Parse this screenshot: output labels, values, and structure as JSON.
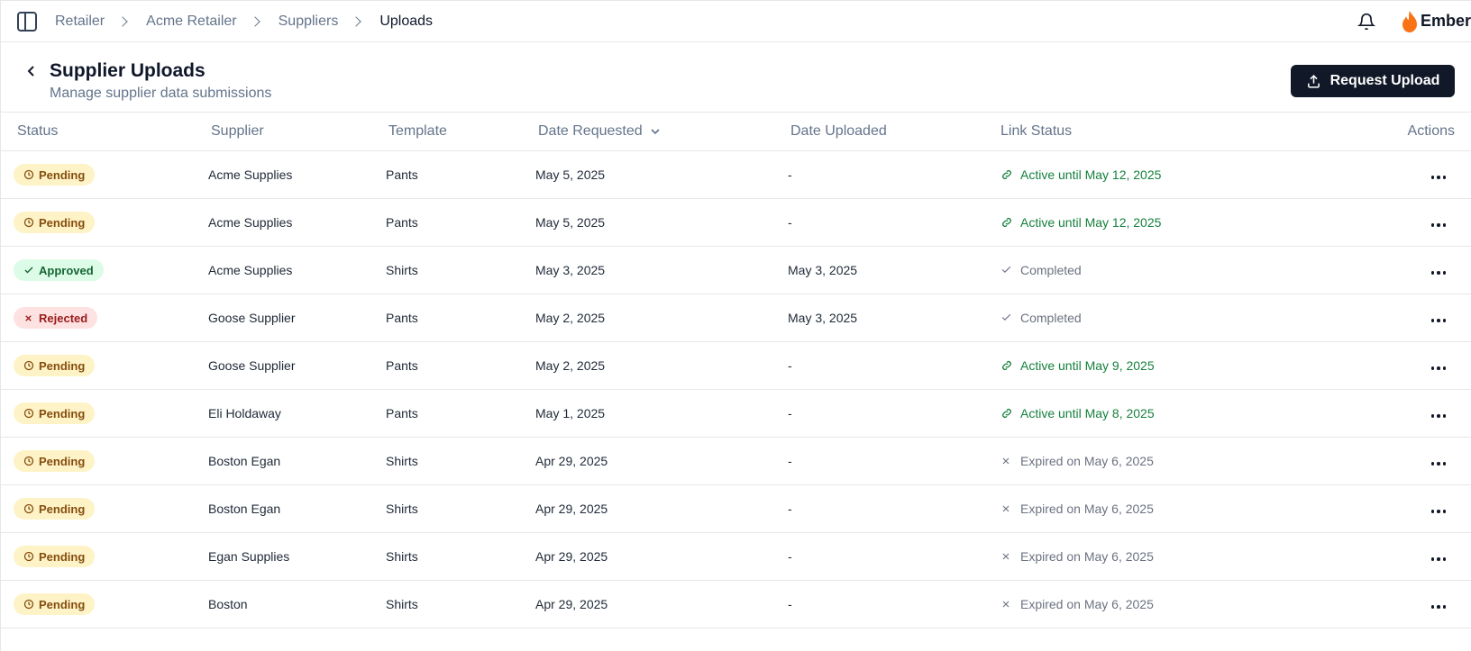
{
  "breadcrumb": [
    "Retailer",
    "Acme Retailer",
    "Suppliers",
    "Uploads"
  ],
  "brand": {
    "name": "Ember",
    "color": "#f97316"
  },
  "header": {
    "title": "Supplier Uploads",
    "subtitle": "Manage supplier data submissions",
    "request_label": "Request Upload"
  },
  "table": {
    "columns": {
      "status": "Status",
      "supplier": "Supplier",
      "template": "Template",
      "date_requested": "Date Requested",
      "date_uploaded": "Date Uploaded",
      "link_status": "Link Status",
      "actions": "Actions"
    },
    "rows": [
      {
        "status": "Pending",
        "supplier": "Acme Supplies",
        "template": "Pants",
        "requested": "May 5, 2025",
        "uploaded": "-",
        "link_type": "active",
        "link": "Active until May 12, 2025"
      },
      {
        "status": "Pending",
        "supplier": "Acme Supplies",
        "template": "Pants",
        "requested": "May 5, 2025",
        "uploaded": "-",
        "link_type": "active",
        "link": "Active until May 12, 2025"
      },
      {
        "status": "Approved",
        "supplier": "Acme Supplies",
        "template": "Shirts",
        "requested": "May 3, 2025",
        "uploaded": "May 3, 2025",
        "link_type": "completed",
        "link": "Completed"
      },
      {
        "status": "Rejected",
        "supplier": "Goose Supplier",
        "template": "Pants",
        "requested": "May 2, 2025",
        "uploaded": "May 3, 2025",
        "link_type": "completed",
        "link": "Completed"
      },
      {
        "status": "Pending",
        "supplier": "Goose Supplier",
        "template": "Pants",
        "requested": "May 2, 2025",
        "uploaded": "-",
        "link_type": "active",
        "link": "Active until May 9, 2025"
      },
      {
        "status": "Pending",
        "supplier": "Eli Holdaway",
        "template": "Pants",
        "requested": "May 1, 2025",
        "uploaded": "-",
        "link_type": "active",
        "link": "Active until May 8, 2025"
      },
      {
        "status": "Pending",
        "supplier": "Boston Egan",
        "template": "Shirts",
        "requested": "Apr 29, 2025",
        "uploaded": "-",
        "link_type": "expired",
        "link": "Expired on May 6, 2025"
      },
      {
        "status": "Pending",
        "supplier": "Boston Egan",
        "template": "Shirts",
        "requested": "Apr 29, 2025",
        "uploaded": "-",
        "link_type": "expired",
        "link": "Expired on May 6, 2025"
      },
      {
        "status": "Pending",
        "supplier": "Egan Supplies",
        "template": "Shirts",
        "requested": "Apr 29, 2025",
        "uploaded": "-",
        "link_type": "expired",
        "link": "Expired on May 6, 2025"
      },
      {
        "status": "Pending",
        "supplier": "Boston",
        "template": "Shirts",
        "requested": "Apr 29, 2025",
        "uploaded": "-",
        "link_type": "expired",
        "link": "Expired on May 6, 2025"
      }
    ]
  }
}
